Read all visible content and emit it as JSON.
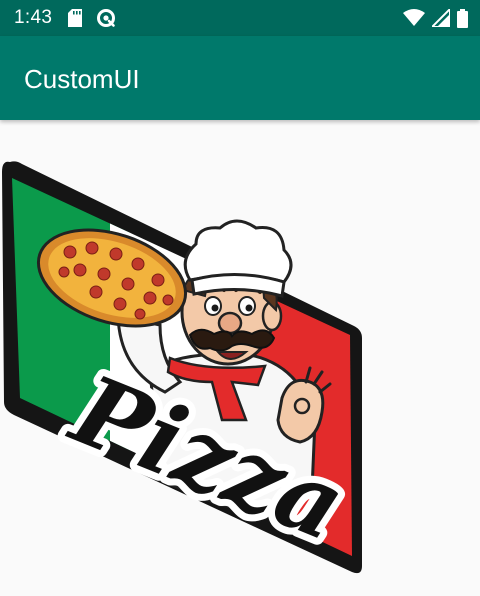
{
  "status_bar": {
    "time": "1:43",
    "icons": [
      "sd-card-icon",
      "data-saver-icon",
      "wifi-icon",
      "cellular-signal-icon",
      "battery-icon"
    ]
  },
  "app_bar": {
    "title": "CustomUI"
  },
  "logo": {
    "text": "Pizza",
    "colors": {
      "green": "#0b9a4b",
      "white": "#ffffff",
      "red": "#e32b2b",
      "border": "#151515"
    }
  }
}
